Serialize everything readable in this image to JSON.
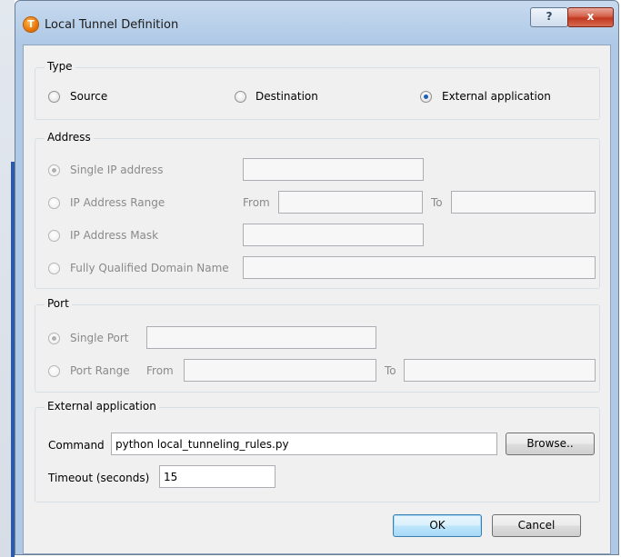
{
  "window": {
    "title": "Local Tunnel Definition",
    "help_label": "?",
    "close_label": "x",
    "app_icon_letter": "T"
  },
  "type_group": {
    "title": "Type",
    "options": [
      {
        "label": "Source",
        "selected": false
      },
      {
        "label": "Destination",
        "selected": false
      },
      {
        "label": "External application",
        "selected": true
      }
    ]
  },
  "address_group": {
    "title": "Address",
    "single_ip": "Single IP address",
    "ip_range": "IP Address Range",
    "ip_mask": "IP Address Mask",
    "fqdn": "Fully Qualified Domain Name",
    "from_label": "From",
    "to_label": "To",
    "selected": "Single IP address"
  },
  "port_group": {
    "title": "Port",
    "single_port": "Single Port",
    "port_range": "Port Range",
    "from_label": "From",
    "to_label": "To",
    "selected": "Single Port"
  },
  "external_group": {
    "title": "External application",
    "command_label": "Command",
    "command_value": "python local_tunneling_rules.py",
    "browse_label": "Browse..",
    "timeout_label": "Timeout (seconds)",
    "timeout_value": "15"
  },
  "buttons": {
    "ok": "OK",
    "cancel": "Cancel"
  },
  "colors": {
    "accent": "#1c5fb8",
    "title_bar": "#b7cfe9",
    "close_button": "#c1381f",
    "dialog_bg": "#f0f0f0"
  }
}
